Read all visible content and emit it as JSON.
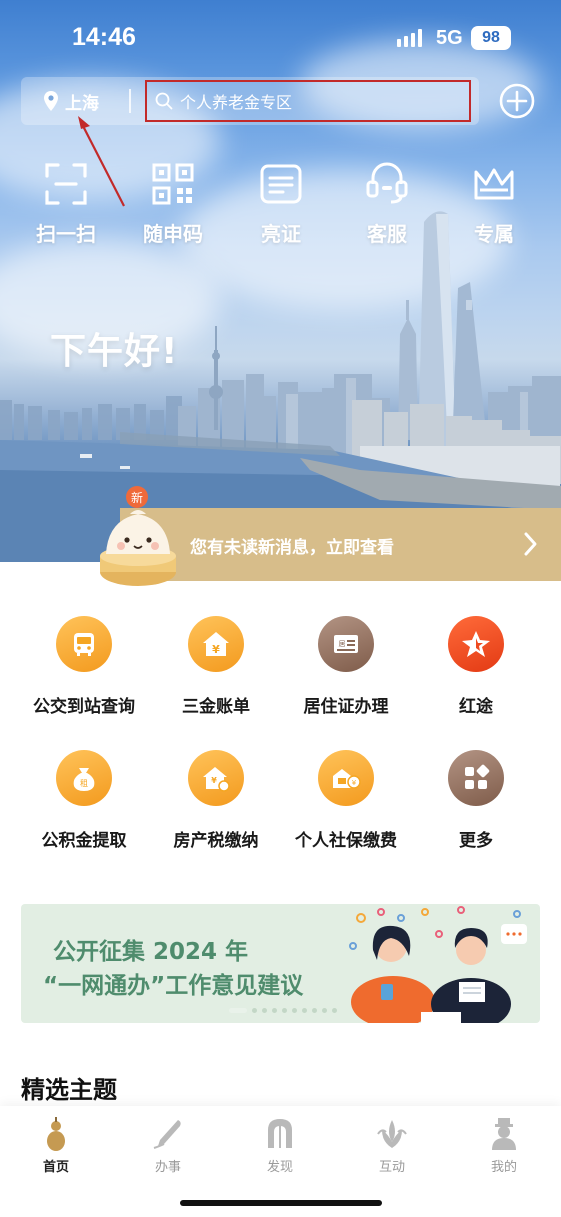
{
  "status_bar": {
    "time": "14:46",
    "network": "5G",
    "battery": "98"
  },
  "header": {
    "location": "上海",
    "search_placeholder": "个人养老金专区"
  },
  "quick_actions": [
    {
      "label": "扫一扫",
      "icon": "scan-icon"
    },
    {
      "label": "随申码",
      "icon": "qr-code-icon"
    },
    {
      "label": "亮证",
      "icon": "certificate-icon"
    },
    {
      "label": "客服",
      "icon": "customer-service-icon"
    },
    {
      "label": "专属",
      "icon": "crown-icon"
    }
  ],
  "greeting": "下午好!",
  "notice": {
    "badge": "新",
    "text": "您有未读新消息，立即查看"
  },
  "services": [
    {
      "label": "公交到站查询",
      "icon": "bus-icon",
      "color": "#f5a623"
    },
    {
      "label": "三金账单",
      "icon": "house-yen-icon",
      "color": "#f5a623"
    },
    {
      "label": "居住证办理",
      "icon": "residence-permit-icon",
      "color": "#9a7663"
    },
    {
      "label": "红途",
      "icon": "red-star-icon",
      "color": "#ee4a1f"
    },
    {
      "label": "公积金提取",
      "icon": "money-bag-icon",
      "color": "#f5a623"
    },
    {
      "label": "房产税缴纳",
      "icon": "house-tax-icon",
      "color": "#f5a623"
    },
    {
      "label": "个人社保缴费",
      "icon": "social-security-icon",
      "color": "#f5a623"
    },
    {
      "label": "更多",
      "icon": "more-apps-icon",
      "color": "#9a7663"
    }
  ],
  "promo": {
    "line1": "公开征集 2024 年",
    "line2": "“一网通办”工作意见建议"
  },
  "section_title": "精选主题",
  "tabs": [
    {
      "label": "首页",
      "icon": "gourd-home-icon",
      "active": true
    },
    {
      "label": "办事",
      "icon": "pen-icon",
      "active": false
    },
    {
      "label": "发现",
      "icon": "arch-icon",
      "active": false
    },
    {
      "label": "互动",
      "icon": "magnolia-icon",
      "active": false
    },
    {
      "label": "我的",
      "icon": "profile-icon",
      "active": false
    }
  ],
  "colors": {
    "accent_orange": "#f5a623",
    "brown": "#9a7663",
    "red": "#ee4a1f",
    "notice_gold": "#d7bd8a",
    "promo_green": "#4f8c6d",
    "annotation_red": "#c22a2a"
  }
}
